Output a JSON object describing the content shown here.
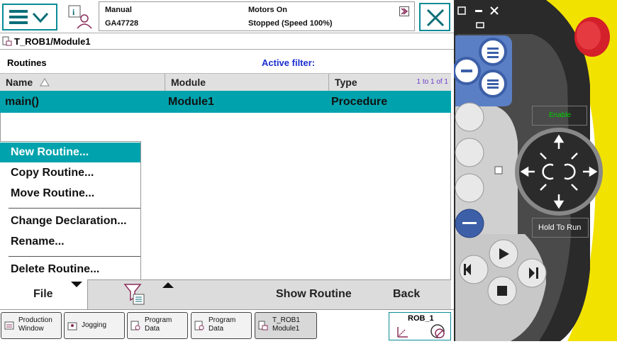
{
  "topbar": {
    "mode": "Manual",
    "controller_name": "GA47728",
    "motors_state": "Motors On",
    "run_state": "Stopped (Speed 100%)"
  },
  "path": {
    "label": "T_ROB1/Module1"
  },
  "routines_header": {
    "title": "Routines",
    "filter_label": "Active filter:"
  },
  "table": {
    "columns": [
      "Name",
      "Module",
      "Type"
    ],
    "pagination": "1 to 1 of 1",
    "rows": [
      {
        "name": "main()",
        "module": "Module1",
        "type": "Procedure"
      }
    ]
  },
  "file_menu": {
    "items": [
      "New Routine...",
      "Copy Routine...",
      "Move Routine...",
      "Change Declaration...",
      "Rename...",
      "Delete Routine..."
    ],
    "selected": "New Routine..."
  },
  "toolbar": {
    "file_label": "File",
    "show_routine_label": "Show Routine",
    "back_label": "Back"
  },
  "taskbar": {
    "items": [
      {
        "line1": "Production",
        "line2": "Window"
      },
      {
        "line1": "Jogging",
        "line2": ""
      },
      {
        "line1": "Program",
        "line2": "Data"
      },
      {
        "line1": "Program",
        "line2": "Data"
      },
      {
        "line1": "T_ROB1",
        "line2": "Module1"
      }
    ],
    "robot": "ROB_1"
  },
  "pendant": {
    "enable_label": "Enable",
    "hold_to_run_label": "Hold To Run"
  },
  "colors": {
    "accent": "#00a3ad",
    "frame": "#0b8b96",
    "pendant_body": "#2a2a2a",
    "pendant_blue": "#5b7fc4",
    "stop_red": "#d4202a",
    "yellow": "#f2e200"
  },
  "icons": [
    "menu-icon",
    "chevron-down-icon",
    "info-user-icon",
    "close-icon",
    "module-icon",
    "sort-up-icon",
    "filter-icon",
    "caret-up-icon",
    "caret-down-icon"
  ]
}
